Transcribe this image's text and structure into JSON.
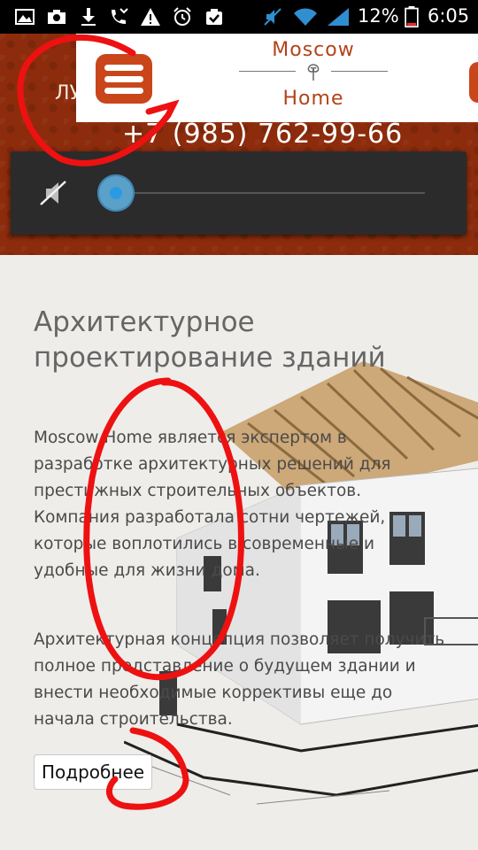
{
  "status_bar": {
    "battery_percent": "12%",
    "time": "6:05",
    "icons": [
      "gallery-icon",
      "camera-icon",
      "download-icon",
      "missed-call-icon",
      "warning-icon",
      "alarm-icon",
      "clipboard-check-icon",
      "mute-icon",
      "wifi-icon",
      "signal-icon",
      "battery-icon"
    ]
  },
  "header": {
    "left_text": "ЛУ",
    "logo": {
      "line1": "Moscow",
      "line2": "Home"
    },
    "phone": "+7 (985) 762-99-66",
    "accent_color": "#c9461a",
    "background_color": "#8c2c0c"
  },
  "player": {
    "volume_icon": "mute-icon",
    "progress": 0.0
  },
  "content": {
    "title": "Архитектурное проектирование зданий",
    "paragraph1": "Moscow Home является экспертом в разработке архитектурных решений для престижных строительных объектов. Компания разработала сотни чертежей, которые воплотились в современные и удобные для жизни дома.",
    "paragraph2": "Архитектурная концепция позволяет получить полное представление о будущем здании и внести необходимые коррективы еще до начала строительства.",
    "more_button": "Подробнее"
  }
}
